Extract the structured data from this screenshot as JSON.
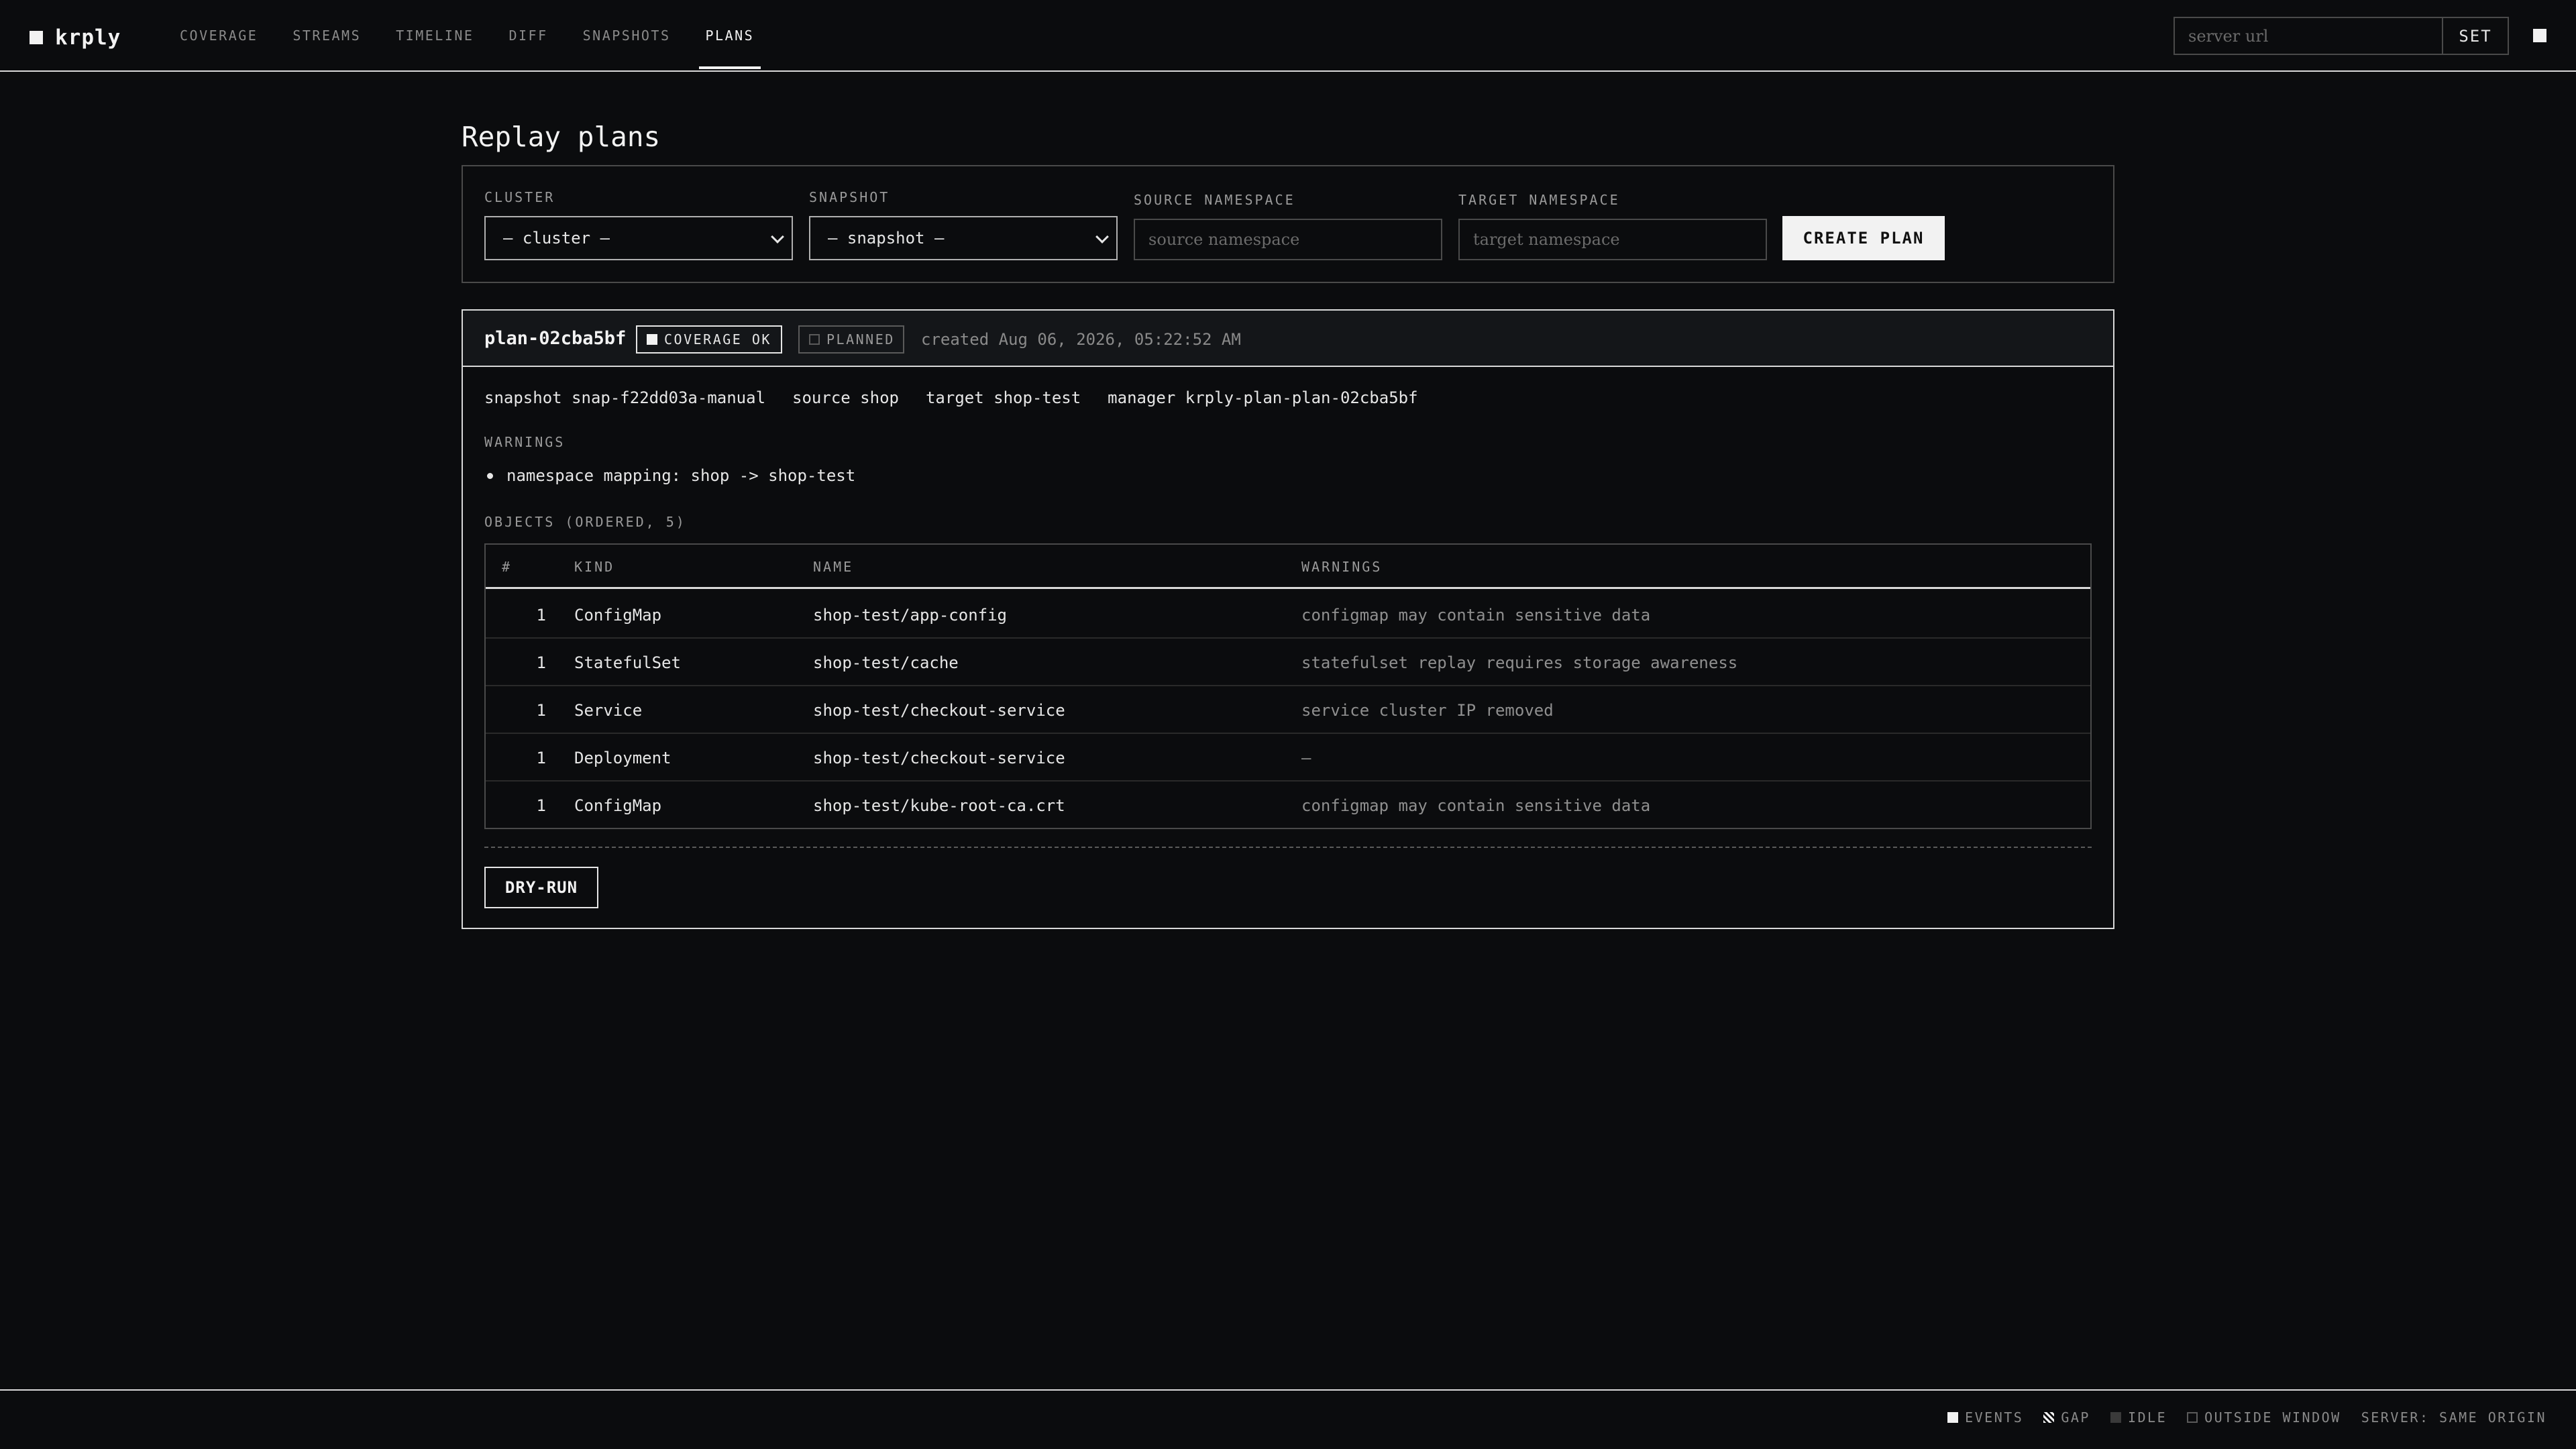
{
  "app": {
    "name": "krply"
  },
  "nav": {
    "items": [
      {
        "label": "COVERAGE"
      },
      {
        "label": "STREAMS"
      },
      {
        "label": "TIMELINE"
      },
      {
        "label": "DIFF"
      },
      {
        "label": "SNAPSHOTS"
      },
      {
        "label": "PLANS",
        "active": true
      }
    ]
  },
  "server": {
    "placeholder": "server url",
    "set_label": "SET"
  },
  "page": {
    "title": "Replay plans"
  },
  "create_form": {
    "cluster_label": "CLUSTER",
    "cluster_value": "— cluster —",
    "snapshot_label": "SNAPSHOT",
    "snapshot_value": "— snapshot —",
    "source_label": "SOURCE NAMESPACE",
    "source_placeholder": "source namespace",
    "target_label": "TARGET NAMESPACE",
    "target_placeholder": "target namespace",
    "create_label": "CREATE PLAN"
  },
  "plan": {
    "id": "plan-02cba5bf",
    "coverage_badge": "COVERAGE OK",
    "status_badge": "PLANNED",
    "created": "created Aug 06, 2026, 05:22:52 AM",
    "meta": {
      "snapshot": "snapshot snap-f22dd03a-manual",
      "source": "source shop",
      "target": "target shop-test",
      "manager": "manager krply-plan-plan-02cba5bf"
    },
    "warnings_label": "WARNINGS",
    "warnings": [
      "namespace mapping: shop -> shop-test"
    ],
    "objects_label": "OBJECTS (ORDERED, 5)",
    "columns": [
      "#",
      "KIND",
      "NAME",
      "WARNINGS"
    ],
    "objects": [
      {
        "idx": "1",
        "kind": "ConfigMap",
        "name": "shop-test/app-config",
        "warning": "configmap may contain sensitive data"
      },
      {
        "idx": "1",
        "kind": "StatefulSet",
        "name": "shop-test/cache",
        "warning": "statefulset replay requires storage awareness"
      },
      {
        "idx": "1",
        "kind": "Service",
        "name": "shop-test/checkout-service",
        "warning": "service cluster IP removed"
      },
      {
        "idx": "1",
        "kind": "Deployment",
        "name": "shop-test/checkout-service",
        "warning": "—"
      },
      {
        "idx": "1",
        "kind": "ConfigMap",
        "name": "shop-test/kube-root-ca.crt",
        "warning": "configmap may contain sensitive data"
      }
    ],
    "dryrun_label": "DRY-RUN"
  },
  "footer": {
    "legend": [
      {
        "label": "EVENTS",
        "icon": "solid-square"
      },
      {
        "label": "GAP",
        "icon": "hatched-square"
      },
      {
        "label": "IDLE",
        "icon": "dim-square"
      },
      {
        "label": "OUTSIDE WINDOW",
        "icon": "outline-square"
      }
    ],
    "server_status": "SERVER: SAME ORIGIN"
  }
}
